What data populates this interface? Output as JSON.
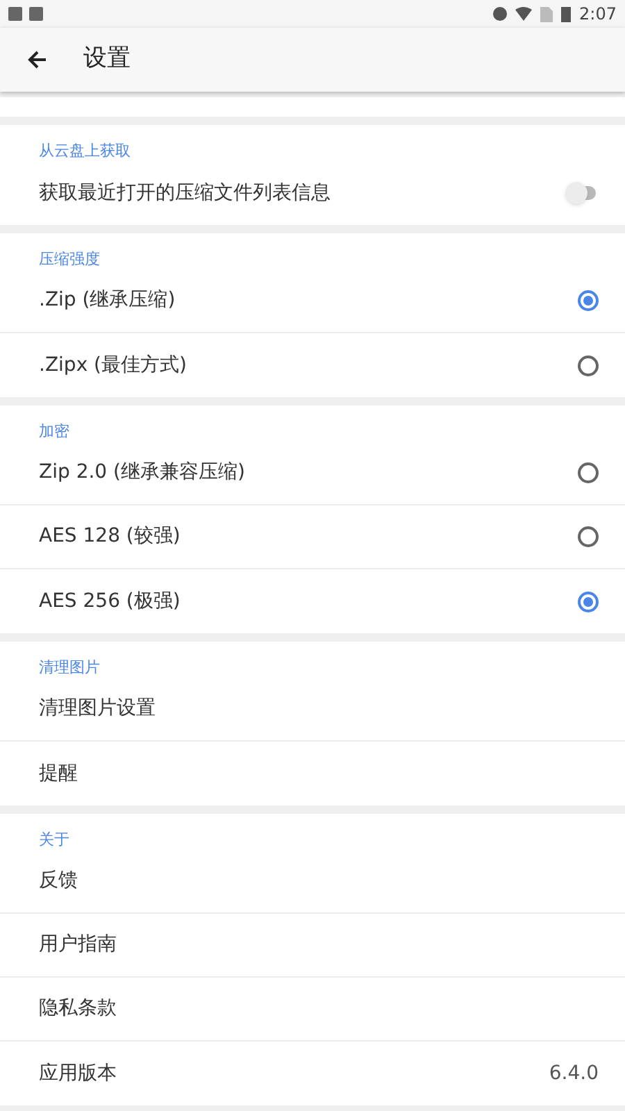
{
  "status_bar": {
    "time": "2:07"
  },
  "toolbar": {
    "title": "设置"
  },
  "sections": [
    {
      "header": "从云盘上获取",
      "rows": [
        {
          "kind": "switch",
          "label": "获取最近打开的压缩文件列表信息",
          "on": false
        }
      ]
    },
    {
      "header": "压缩强度",
      "rows": [
        {
          "kind": "radio",
          "label": ".Zip (继承压缩)",
          "selected": true
        },
        {
          "kind": "radio",
          "label": ".Zipx (最佳方式)",
          "selected": false
        }
      ]
    },
    {
      "header": "加密",
      "rows": [
        {
          "kind": "radio",
          "label": "Zip 2.0 (继承兼容压缩)",
          "selected": false
        },
        {
          "kind": "radio",
          "label": "AES 128 (较强)",
          "selected": false
        },
        {
          "kind": "radio",
          "label": "AES 256 (极强)",
          "selected": true
        }
      ]
    },
    {
      "header": "清理图片",
      "rows": [
        {
          "kind": "plain",
          "label": "清理图片设置"
        },
        {
          "kind": "plain",
          "label": "提醒"
        }
      ]
    },
    {
      "header": "关于",
      "rows": [
        {
          "kind": "plain",
          "label": "反馈"
        },
        {
          "kind": "plain",
          "label": "用户指南"
        },
        {
          "kind": "plain",
          "label": "隐私条款"
        },
        {
          "kind": "value",
          "label": "应用版本",
          "value": "6.4.0"
        }
      ]
    }
  ]
}
